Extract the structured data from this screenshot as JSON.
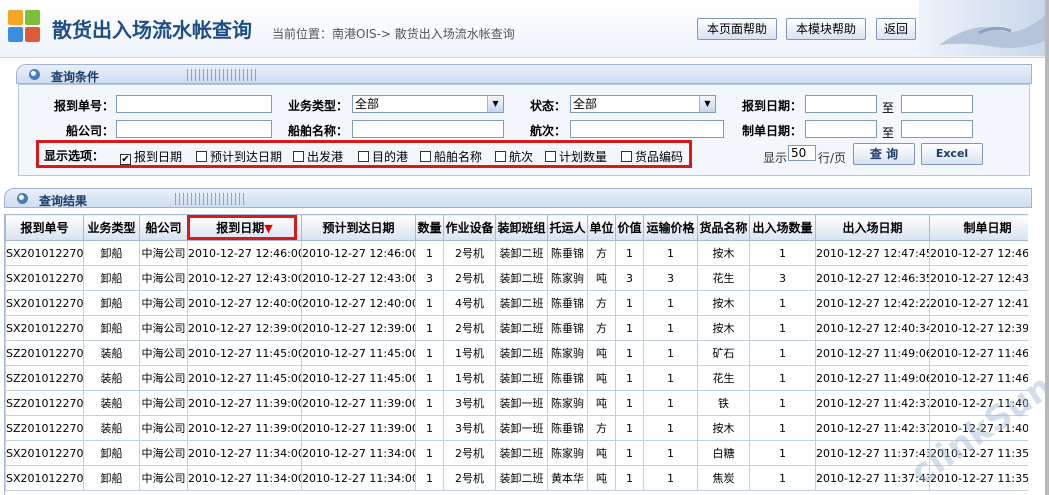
{
  "header": {
    "title": "散货出入场流水帐查询",
    "location": "当前位置：南港OIS-> 散货出入场流水帐查询",
    "buttons": [
      "本页面帮助",
      "本模块帮助",
      "返回"
    ]
  },
  "query_panel": {
    "title": "查询条件",
    "fields": {
      "report_no_label": "报到单号：",
      "business_type_label": "业务类型：",
      "business_type_value": "全部",
      "status_label": "状态：",
      "status_value": "全部",
      "report_date_label": "报到日期：",
      "to1": "至",
      "ship_company_label": "船公司：",
      "ship_name_label": "船舶名称：",
      "voyage_label": "航次：",
      "create_date_label": "制单日期：",
      "to2": "至"
    },
    "display_options_label": "显示选项：",
    "display_options": [
      {
        "label": "报到日期",
        "checked": true
      },
      {
        "label": "预计到达日期",
        "checked": false
      },
      {
        "label": "出发港",
        "checked": false
      },
      {
        "label": "目的港",
        "checked": false
      },
      {
        "label": "船舶名称",
        "checked": false
      },
      {
        "label": "航次",
        "checked": false
      },
      {
        "label": "计划数量",
        "checked": false
      },
      {
        "label": "货品编码",
        "checked": false
      }
    ],
    "show_prefix": "显示",
    "page_size": "50",
    "show_suffix": "行/页",
    "query_button": "查 询",
    "excel_button": "Excel"
  },
  "results_panel": {
    "title": "查询结果",
    "sort_arrow": "▼",
    "columns": [
      "报到单号",
      "业务类型",
      "船公司",
      "报到日期",
      "预计到达日期",
      "数量",
      "作业设备",
      "装卸班组",
      "托运人",
      "单位",
      "价值",
      "运输价格",
      "货品名称",
      "出入场数量",
      "出入场日期",
      "制单日期"
    ],
    "rows": [
      [
        "SX20101227008",
        "卸船",
        "中海公司",
        "2010-12-27 12:46:00",
        "2010-12-27 12:46:00",
        "1",
        "2号机",
        "装卸二班",
        "陈垂锦",
        "方",
        "1",
        "1",
        "按木",
        "1",
        "2010-12-27 12:47:45",
        "2010-12-27 12:46"
      ],
      [
        "SX20101227007",
        "卸船",
        "中海公司",
        "2010-12-27 12:43:00",
        "2010-12-27 12:43:00",
        "3",
        "2号机",
        "装卸二班",
        "陈家驹",
        "吨",
        "3",
        "3",
        "花生",
        "3",
        "2010-12-27 12:46:35",
        "2010-12-27 12:43"
      ],
      [
        "SX20101227006",
        "卸船",
        "中海公司",
        "2010-12-27 12:40:00",
        "2010-12-27 12:40:00",
        "1",
        "4号机",
        "装卸二班",
        "陈垂锦",
        "方",
        "1",
        "1",
        "按木",
        "1",
        "2010-12-27 12:42:22",
        "2010-12-27 12:41"
      ],
      [
        "SX20101227005",
        "卸船",
        "中海公司",
        "2010-12-27 12:39:00",
        "2010-12-27 12:39:00",
        "1",
        "2号机",
        "装卸二班",
        "陈垂锦",
        "方",
        "1",
        "1",
        "按木",
        "1",
        "2010-12-27 12:40:34",
        "2010-12-27 12:39"
      ],
      [
        "SZ20101227004",
        "装船",
        "中海公司",
        "2010-12-27 11:45:00",
        "2010-12-27 11:45:00",
        "1",
        "1号机",
        "装卸二班",
        "陈家驹",
        "吨",
        "1",
        "1",
        "矿石",
        "1",
        "2010-12-27 11:49:06",
        "2010-12-27 11:46"
      ],
      [
        "SZ20101227004",
        "装船",
        "中海公司",
        "2010-12-27 11:45:00",
        "2010-12-27 11:45:00",
        "1",
        "1号机",
        "装卸二班",
        "陈垂锦",
        "吨",
        "1",
        "1",
        "花生",
        "1",
        "2010-12-27 11:49:06",
        "2010-12-27 11:46"
      ],
      [
        "SZ20101227003",
        "装船",
        "中海公司",
        "2010-12-27 11:39:00",
        "2010-12-27 11:39:00",
        "1",
        "3号机",
        "装卸一班",
        "陈家驹",
        "吨",
        "1",
        "1",
        "铁",
        "1",
        "2010-12-27 11:42:37",
        "2010-12-27 11:40"
      ],
      [
        "SZ20101227003",
        "装船",
        "中海公司",
        "2010-12-27 11:39:00",
        "2010-12-27 11:39:00",
        "1",
        "3号机",
        "装卸一班",
        "陈垂锦",
        "方",
        "1",
        "1",
        "按木",
        "1",
        "2010-12-27 11:42:37",
        "2010-12-27 11:40"
      ],
      [
        "SX20101227002",
        "卸船",
        "中海公司",
        "2010-12-27 11:34:00",
        "2010-12-27 11:34:00",
        "1",
        "2号机",
        "装卸二班",
        "陈家驹",
        "吨",
        "1",
        "1",
        "白糖",
        "1",
        "2010-12-27 11:37:43",
        "2010-12-27 11:35"
      ],
      [
        "SX20101227002",
        "卸船",
        "中海公司",
        "2010-12-27 11:34:00",
        "2010-12-27 11:34:00",
        "1",
        "2号机",
        "装卸二班",
        "黄本华",
        "吨",
        "1",
        "1",
        "焦炭",
        "1",
        "2010-12-27 11:37:43",
        "2010-12-27 11:35"
      ]
    ]
  },
  "watermark": "clinkSun",
  "colors": {
    "accent": "#1d4e87",
    "highlight_box": "#d91a1a",
    "sort_arrow": "#e00000"
  }
}
